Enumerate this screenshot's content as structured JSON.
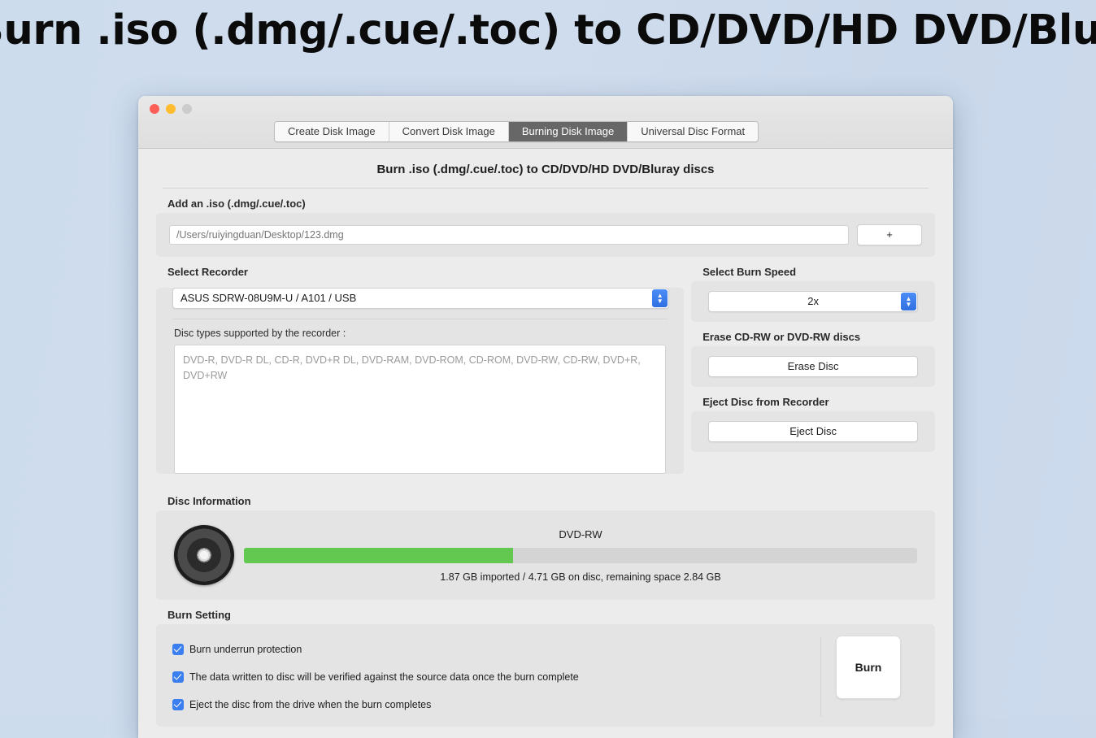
{
  "caption": "Burn .iso (.dmg/.cue/.toc) to CD/DVD/HD DVD/Bluray discs",
  "window": {
    "traffic_lights": [
      "close",
      "minimize",
      "zoom"
    ],
    "tabs": [
      {
        "label": "Create Disk Image",
        "active": false
      },
      {
        "label": "Convert Disk Image",
        "active": false
      },
      {
        "label": "Burning Disk Image",
        "active": true
      },
      {
        "label": "Universal Disc Format",
        "active": false
      }
    ]
  },
  "page_title": "Burn .iso (.dmg/.cue/.toc) to CD/DVD/HD DVD/Bluray discs",
  "add_iso": {
    "label": "Add an .iso (.dmg/.cue/.toc)",
    "path_placeholder": "/Users/ruiyingduan/Desktop/123.dmg",
    "path_value": "",
    "add_button": "+"
  },
  "recorder": {
    "label": "Select Recorder",
    "selected": "ASUS SDRW-08U9M-U / A101 / USB",
    "disc_types_label": "Disc types supported by the recorder :",
    "disc_types": "DVD-R, DVD-R DL, CD-R, DVD+R DL, DVD-RAM, DVD-ROM, CD-ROM, DVD-RW, CD-RW, DVD+R, DVD+RW"
  },
  "burn_speed": {
    "label": "Select Burn Speed",
    "selected": "2x"
  },
  "erase": {
    "label": "Erase CD-RW or DVD-RW discs",
    "button": "Erase Disc"
  },
  "eject": {
    "label": "Eject Disc from Recorder",
    "button": "Eject Disc"
  },
  "disc_information": {
    "label": "Disc Information",
    "disc_type": "DVD-RW",
    "status": "1.87 GB imported / 4.71 GB on disc, remaining space 2.84 GB",
    "progress_percent": 40,
    "progress_color": "#62c84f",
    "imported_gb": "1.87 GB",
    "capacity_gb": "4.71 GB",
    "remaining_gb": "2.84 GB"
  },
  "burn_setting": {
    "label": "Burn Setting",
    "options": [
      {
        "label": "Burn underrun protection",
        "checked": true
      },
      {
        "label": "The data written to disc will be verified against the source data once the burn complete",
        "checked": true
      },
      {
        "label": "Eject the disc from the drive when the burn completes",
        "checked": true
      }
    ],
    "burn_button": "Burn"
  },
  "colors": {
    "desktop_background": "#cfdcee",
    "window_background": "#ececec",
    "panel_background": "#e4e4e4",
    "active_tab": "#676767",
    "accent_blue": "#3b7ef0",
    "progress_green": "#62c84f"
  }
}
